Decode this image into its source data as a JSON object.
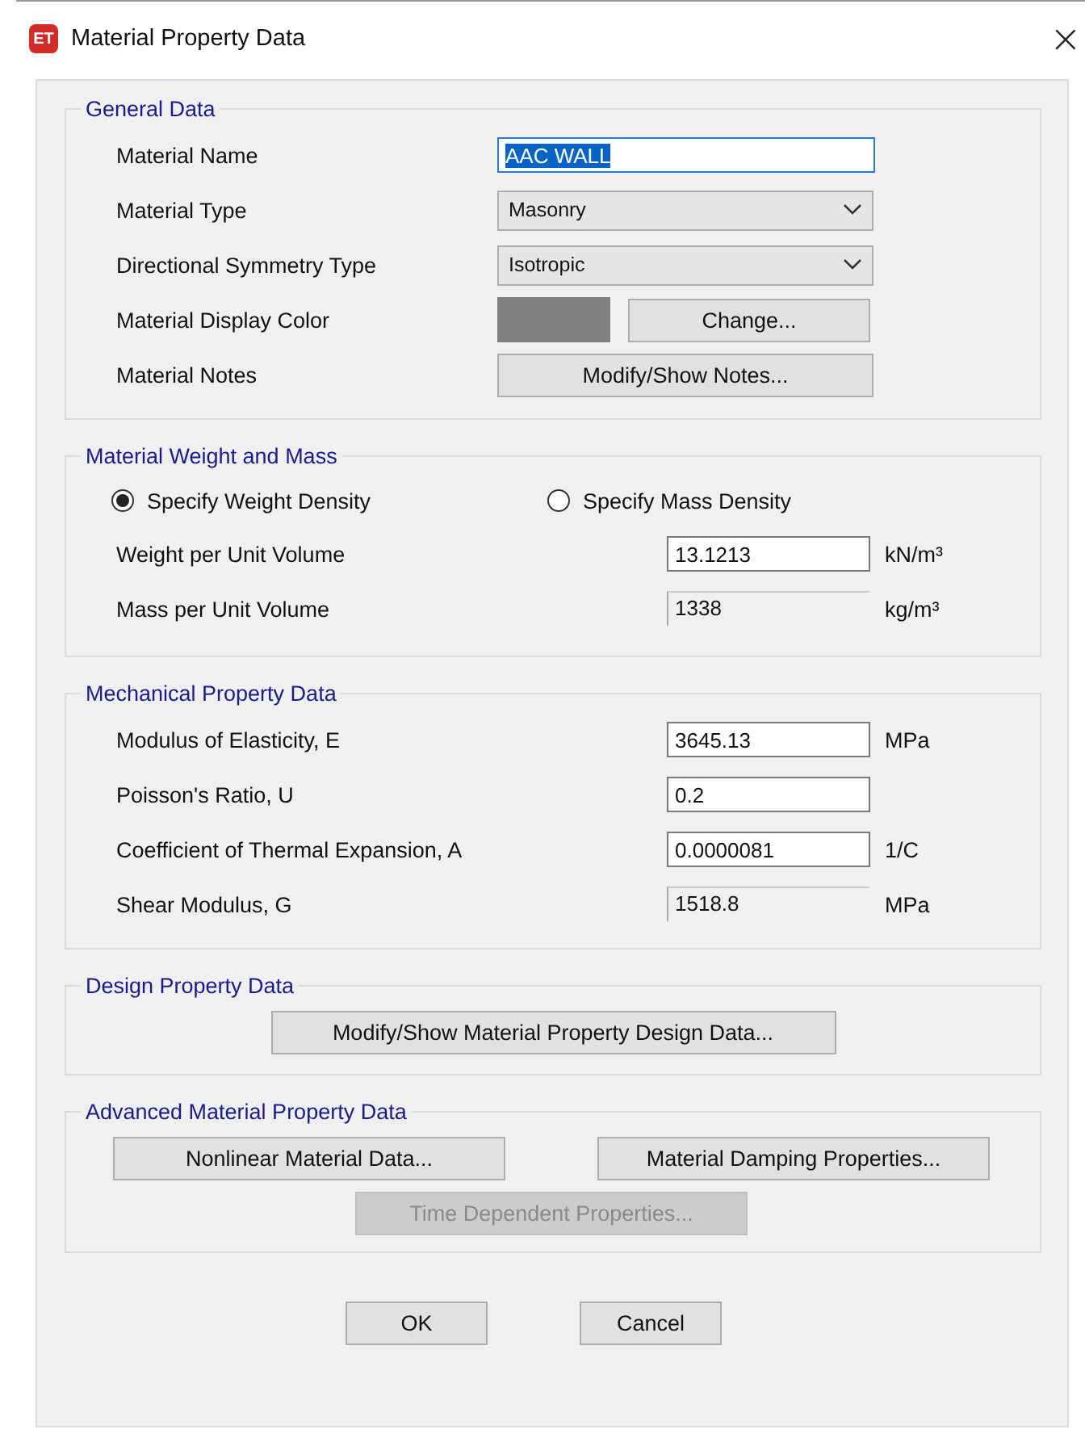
{
  "window": {
    "app_icon": "ET",
    "title": "Material Property Data",
    "close": "×"
  },
  "general_data": {
    "title": "General Data",
    "rows": [
      {
        "kind": "text",
        "label": "Material Name",
        "value": "AAC WALL",
        "text_selected": true
      },
      {
        "kind": "dropdown",
        "label": "Material Type",
        "value": "Masonry"
      },
      {
        "kind": "dropdown",
        "label": "Directional Symmetry Type",
        "value": "Isotropic"
      },
      {
        "kind": "color",
        "label": "Material Display Color",
        "color": "#808080",
        "button": "Change..."
      },
      {
        "kind": "button",
        "label": "Material Notes",
        "button": "Modify/Show Notes..."
      }
    ]
  },
  "weight_and_mass": {
    "title": "Material Weight and Mass",
    "options": [
      {
        "label": "Specify Weight Density",
        "selected": true
      },
      {
        "label": "Specify Mass Density",
        "selected": false
      }
    ],
    "rows": [
      {
        "label": "Weight per Unit Volume",
        "value": "13.1213",
        "unit": "kN/m³",
        "read_only": false
      },
      {
        "label": "Mass per Unit Volume",
        "value": "1338",
        "unit": "kg/m³",
        "read_only": true
      }
    ]
  },
  "mechanical": {
    "title": "Mechanical Property Data",
    "rows": [
      {
        "label": "Modulus of Elasticity,  E",
        "value": "3645.13",
        "unit": "MPa",
        "read_only": false
      },
      {
        "label": "Poisson's Ratio,  U",
        "value": "0.2",
        "read_only": false
      },
      {
        "label": "Coefficient of Thermal Expansion,  A",
        "value": "0.0000081",
        "unit": "1/C",
        "read_only": false
      },
      {
        "label": "Shear Modulus,  G",
        "value": "1518.8",
        "unit": "MPa",
        "read_only": true
      }
    ]
  },
  "design": {
    "title": "Design Property Data",
    "button": "Modify/Show Material Property Design Data..."
  },
  "advanced": {
    "title": "Advanced Material Property Data",
    "buttons": [
      {
        "label": "Nonlinear Material Data...",
        "disabled": false
      },
      {
        "label": "Material Damping Properties...",
        "disabled": false
      },
      {
        "label": "Time Dependent Properties...",
        "disabled": true
      }
    ]
  },
  "buttons": [
    "OK",
    "Cancel"
  ]
}
